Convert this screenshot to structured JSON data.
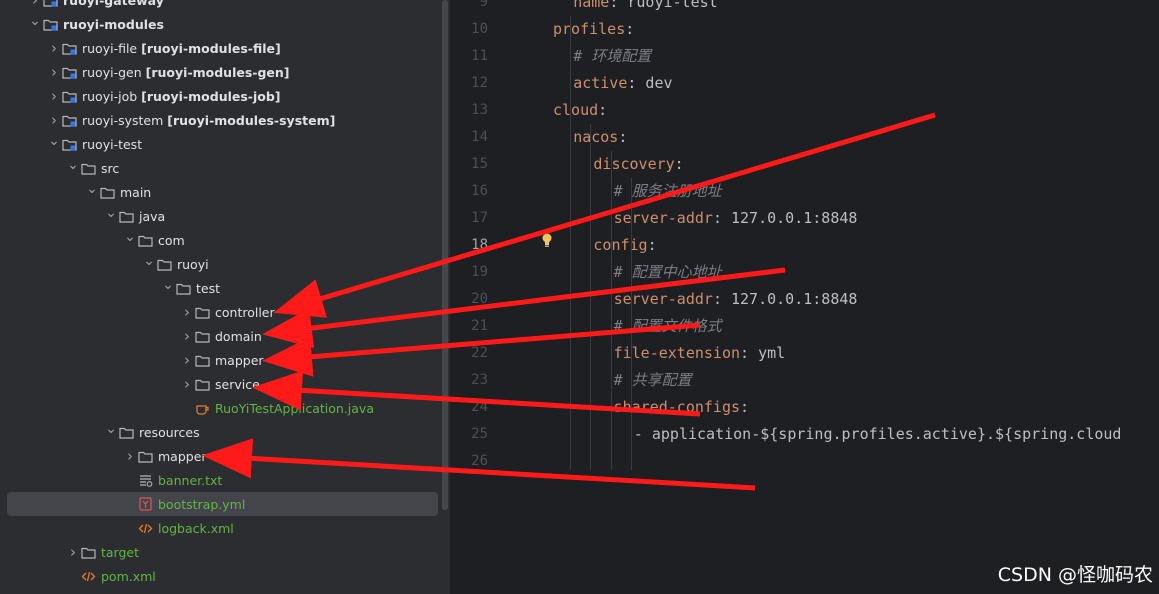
{
  "project_tree": {
    "items": [
      {
        "label": "ruoyi-gateway",
        "module": "",
        "icon": "module-folder-icon",
        "depth": 1,
        "chevron": "right",
        "bold": true
      },
      {
        "label": "ruoyi-modules",
        "module": "",
        "icon": "module-folder-icon",
        "depth": 1,
        "chevron": "down",
        "bold": true
      },
      {
        "label": "ruoyi-file",
        "module": "[ruoyi-modules-file]",
        "icon": "module-folder-icon",
        "depth": 2,
        "chevron": "right"
      },
      {
        "label": "ruoyi-gen",
        "module": "[ruoyi-modules-gen]",
        "icon": "module-folder-icon",
        "depth": 2,
        "chevron": "right"
      },
      {
        "label": "ruoyi-job",
        "module": "[ruoyi-modules-job]",
        "icon": "module-folder-icon",
        "depth": 2,
        "chevron": "right"
      },
      {
        "label": "ruoyi-system",
        "module": "[ruoyi-modules-system]",
        "icon": "module-folder-icon",
        "depth": 2,
        "chevron": "right"
      },
      {
        "label": "ruoyi-test",
        "module": "",
        "icon": "module-folder-icon",
        "depth": 2,
        "chevron": "down"
      },
      {
        "label": "src",
        "module": "",
        "icon": "folder-icon",
        "depth": 3,
        "chevron": "down"
      },
      {
        "label": "main",
        "module": "",
        "icon": "folder-icon",
        "depth": 4,
        "chevron": "down"
      },
      {
        "label": "java",
        "module": "",
        "icon": "folder-icon",
        "depth": 5,
        "chevron": "down"
      },
      {
        "label": "com",
        "module": "",
        "icon": "folder-icon",
        "depth": 6,
        "chevron": "down"
      },
      {
        "label": "ruoyi",
        "module": "",
        "icon": "folder-icon",
        "depth": 7,
        "chevron": "down"
      },
      {
        "label": "test",
        "module": "",
        "icon": "folder-icon",
        "depth": 8,
        "chevron": "down"
      },
      {
        "label": "controller",
        "module": "",
        "icon": "folder-icon",
        "depth": 9,
        "chevron": "right"
      },
      {
        "label": "domain",
        "module": "",
        "icon": "folder-icon",
        "depth": 9,
        "chevron": "right"
      },
      {
        "label": "mapper",
        "module": "",
        "icon": "folder-icon",
        "depth": 9,
        "chevron": "right"
      },
      {
        "label": "service",
        "module": "",
        "icon": "folder-icon",
        "depth": 9,
        "chevron": "right"
      },
      {
        "label": "RuoYiTestApplication.java",
        "module": "",
        "icon": "java-class-icon",
        "depth": 9,
        "chevron": "none",
        "green": true
      },
      {
        "label": "resources",
        "module": "",
        "icon": "folder-icon",
        "depth": 5,
        "chevron": "down"
      },
      {
        "label": "mapper",
        "module": "",
        "icon": "folder-icon",
        "depth": 6,
        "chevron": "right"
      },
      {
        "label": "banner.txt",
        "module": "",
        "icon": "text-file-icon",
        "depth": 6,
        "chevron": "none",
        "green": true
      },
      {
        "label": "bootstrap.yml",
        "module": "",
        "icon": "yaml-file-icon",
        "depth": 6,
        "chevron": "none",
        "green": true,
        "selected": true
      },
      {
        "label": "logback.xml",
        "module": "",
        "icon": "xml-file-icon",
        "depth": 6,
        "chevron": "none",
        "green": true
      },
      {
        "label": "target",
        "module": "",
        "icon": "folder-icon",
        "depth": 3,
        "chevron": "right",
        "green": true
      },
      {
        "label": "pom.xml",
        "module": "",
        "icon": "maven-file-icon",
        "depth": 3,
        "chevron": "none",
        "green": true
      }
    ]
  },
  "editor": {
    "current_line": 18,
    "lines": [
      {
        "num": "9",
        "indent": 1,
        "key": "name",
        "colon": ":",
        "value": " ruoyi-test",
        "comment": ""
      },
      {
        "num": "10",
        "indent": 0,
        "key": "profiles",
        "colon": ":",
        "value": "",
        "comment": ""
      },
      {
        "num": "11",
        "indent": 1,
        "key": "",
        "colon": "",
        "value": "",
        "comment": "# 环境配置"
      },
      {
        "num": "12",
        "indent": 1,
        "key": "active",
        "colon": ":",
        "value": " dev",
        "comment": ""
      },
      {
        "num": "13",
        "indent": 0,
        "key": "cloud",
        "colon": ":",
        "value": "",
        "comment": ""
      },
      {
        "num": "14",
        "indent": 1,
        "key": "nacos",
        "colon": ":",
        "value": "",
        "comment": ""
      },
      {
        "num": "15",
        "indent": 2,
        "key": "discovery",
        "colon": ":",
        "value": "",
        "comment": ""
      },
      {
        "num": "16",
        "indent": 3,
        "key": "",
        "colon": "",
        "value": "",
        "comment": "# 服务注册地址"
      },
      {
        "num": "17",
        "indent": 3,
        "key": "server-addr",
        "colon": ":",
        "value": " 127.0.0.1:8848",
        "comment": ""
      },
      {
        "num": "18",
        "indent": 2,
        "key": "config",
        "colon": ":",
        "value": "",
        "comment": ""
      },
      {
        "num": "19",
        "indent": 3,
        "key": "",
        "colon": "",
        "value": "",
        "comment": "# 配置中心地址"
      },
      {
        "num": "20",
        "indent": 3,
        "key": "server-addr",
        "colon": ":",
        "value": " 127.0.0.1:8848",
        "comment": ""
      },
      {
        "num": "21",
        "indent": 3,
        "key": "",
        "colon": "",
        "value": "",
        "comment": "# 配置文件格式"
      },
      {
        "num": "22",
        "indent": 3,
        "key": "file-extension",
        "colon": ":",
        "value": " yml",
        "comment": ""
      },
      {
        "num": "23",
        "indent": 3,
        "key": "",
        "colon": "",
        "value": "",
        "comment": "# 共享配置"
      },
      {
        "num": "24",
        "indent": 3,
        "key": "shared-configs",
        "colon": ":",
        "value": "",
        "comment": ""
      },
      {
        "num": "25",
        "indent": 4,
        "key": "",
        "colon": "",
        "value": "- application-${spring.profiles.active}.${spring.cloud",
        "comment": ""
      },
      {
        "num": "26",
        "indent": 0,
        "key": "",
        "colon": "",
        "value": "",
        "comment": ""
      }
    ]
  },
  "watermark": "CSDN @怪咖码农",
  "colors": {
    "arrow": "#ff1a1a",
    "key": "#cf8e6d",
    "comment": "#7a7e85",
    "green_file": "#62b543"
  }
}
